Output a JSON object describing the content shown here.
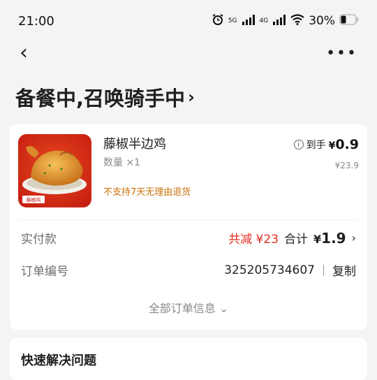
{
  "status_bar": {
    "time": "21:00",
    "net1": "5G",
    "net2": "4G",
    "battery": "30%"
  },
  "nav": {
    "back": "‹",
    "more": "•••"
  },
  "order": {
    "status": "备餐中,召唤骑手中",
    "chevron": "›"
  },
  "product": {
    "image_label": "藤椒鸡",
    "name": "藤椒半边鸡",
    "qty": "数量 ×1",
    "note": "不支持7天无理由退货",
    "after_label": "到手",
    "after_currency": "¥",
    "after_price": "0.9",
    "orig_price": "¥23.9"
  },
  "payment": {
    "label": "实付款",
    "discount": "共减 ¥23",
    "total_label": "合计",
    "total_currency": "¥",
    "total_price": "1.9",
    "chevron": "›"
  },
  "order_no": {
    "label": "订单编号",
    "value": "325205734607",
    "copy": "复制"
  },
  "all_info": "全部订单信息 ⌄",
  "section2": {
    "title": "快速解决问题"
  },
  "colors": {
    "discount": "#e02e24",
    "note": "#c9710b"
  }
}
